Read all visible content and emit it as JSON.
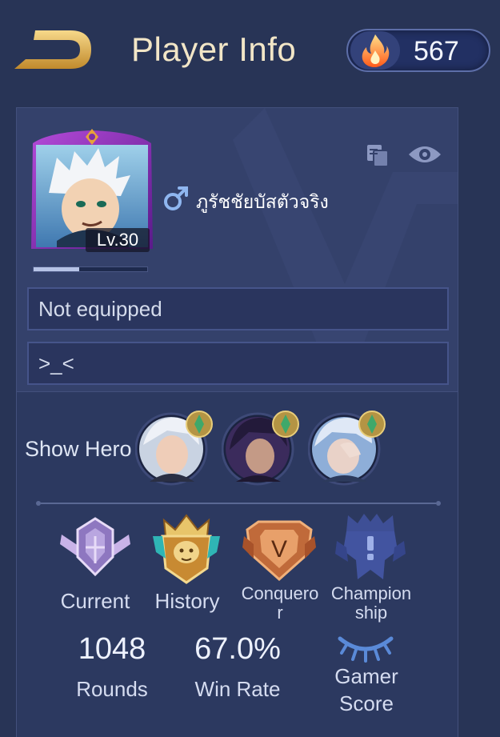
{
  "header": {
    "title": "Player Info",
    "currency_value": "567",
    "back_icon": "back-arrow-icon",
    "currency_icon": "flame-icon"
  },
  "profile": {
    "level": "Lv.30",
    "exp_progress": 0.4,
    "gender_icon": "male-icon",
    "name": "ภูรัชชัยบัสตัวจริง",
    "title_field": "Not equipped",
    "signature": ">_<"
  },
  "show_hero": {
    "label": "Show Hero",
    "heroes": [
      "hero-1",
      "hero-2",
      "hero-3"
    ]
  },
  "ranks": [
    {
      "label": "Current",
      "icon": "current-rank-icon"
    },
    {
      "label": "History",
      "icon": "history-rank-icon"
    },
    {
      "label_line1": "Conquero",
      "label_line2": "r",
      "icon": "conqueror-badge-icon"
    },
    {
      "label_line1": "Champion",
      "label_line2": "ship",
      "icon": "championship-icon"
    }
  ],
  "stats": {
    "rounds_value": "1048",
    "rounds_label": "Rounds",
    "winrate_value": "67.0%",
    "winrate_label": "Win Rate",
    "gamer_label_line1": "Gamer",
    "gamer_label_line2": "Score"
  },
  "colors": {
    "background": "#283456",
    "card": "#34416b",
    "accent_gold": "#e2b95c",
    "title_text": "#f2e6c7"
  }
}
